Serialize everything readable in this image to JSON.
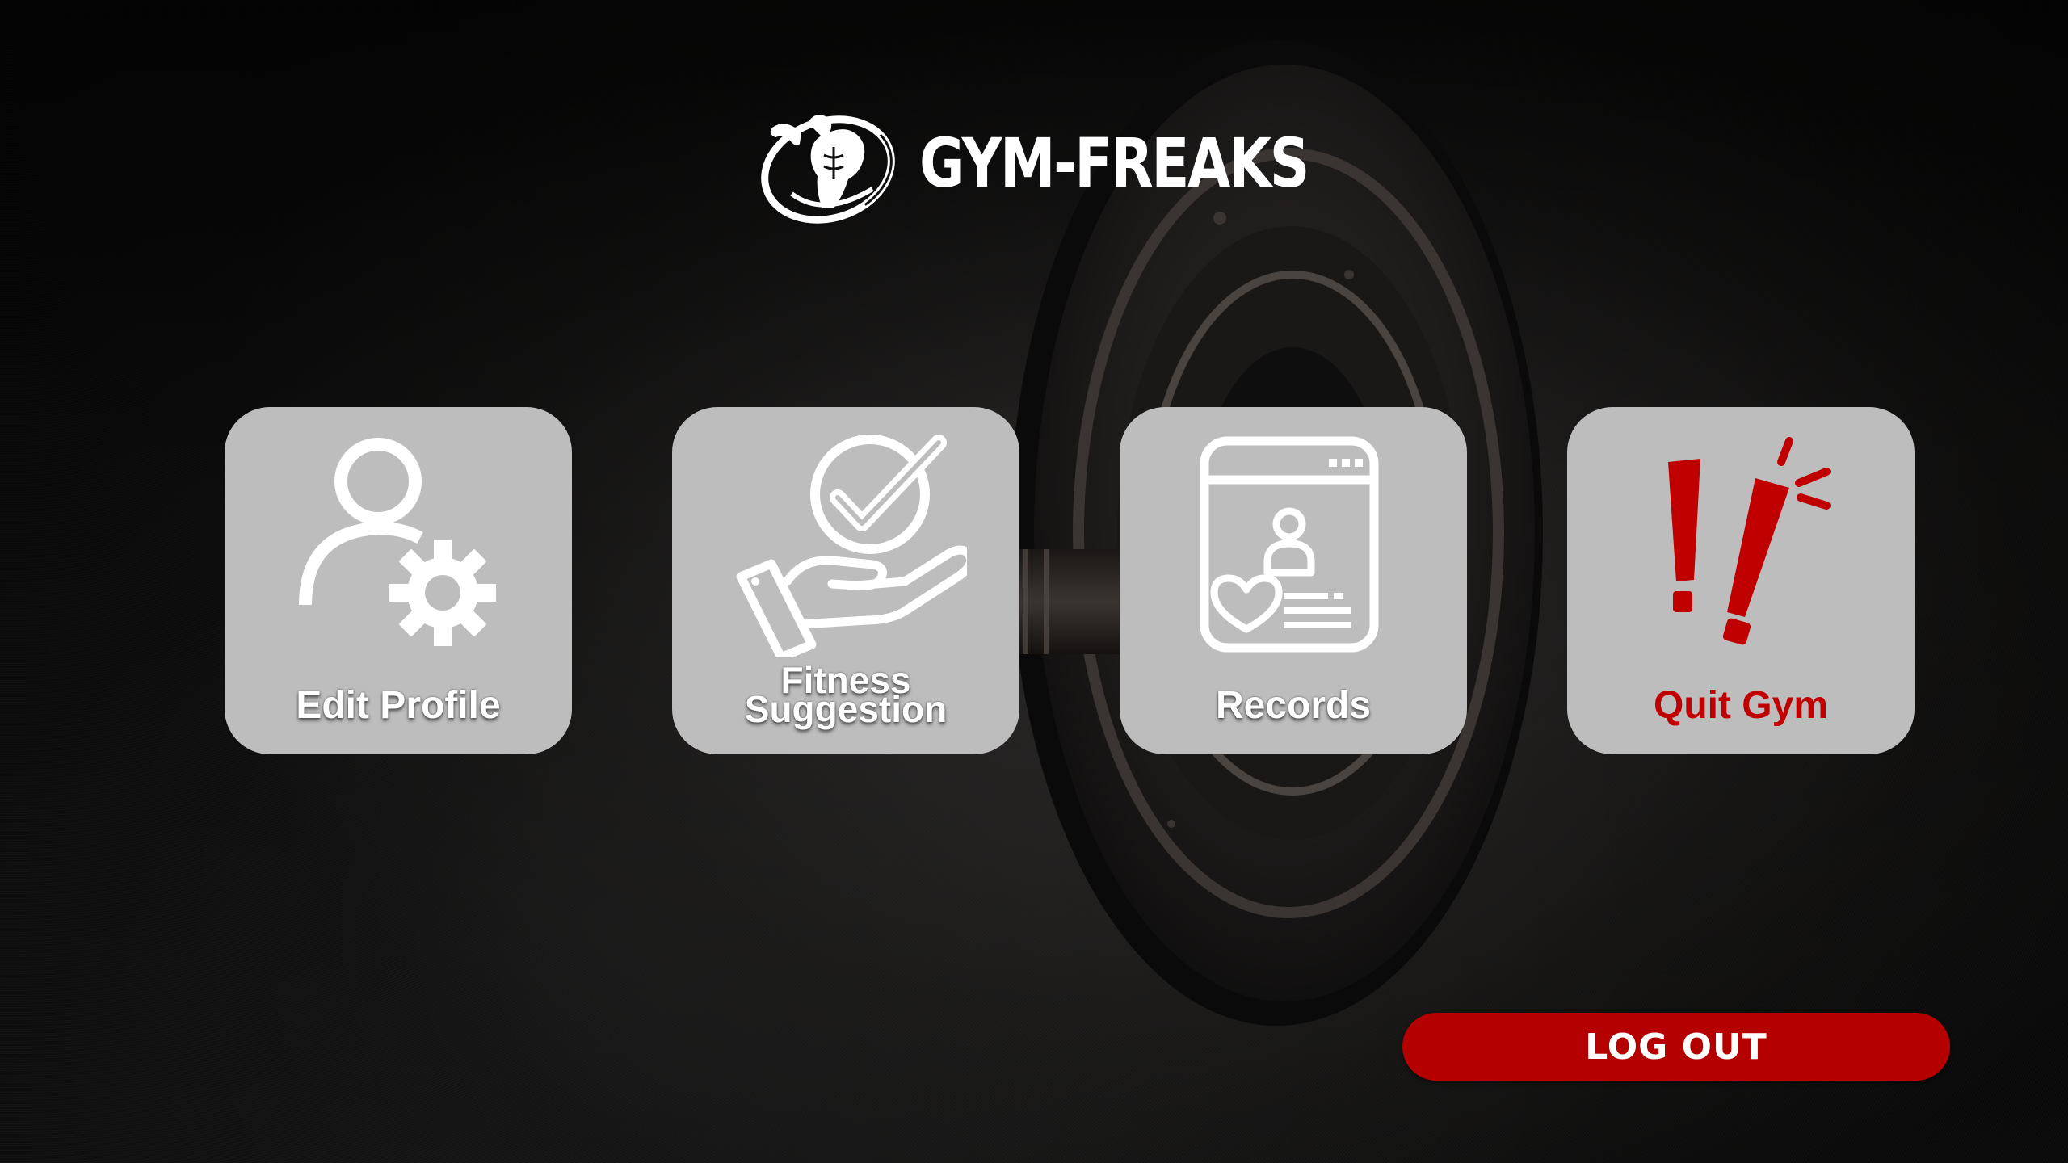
{
  "brand": {
    "name": "GYM-FREAKS",
    "logo_icon": "bodybuilder-logo-icon"
  },
  "tiles": [
    {
      "label": "Edit Profile",
      "icon": "user-gear-icon"
    },
    {
      "label_line1": "Fitness",
      "label_line2": "Suggestion",
      "icon": "hand-checkmark-icon"
    },
    {
      "label": "Records",
      "icon": "profile-card-icon"
    },
    {
      "label": "Quit Gym",
      "icon": "exclamation-icon"
    }
  ],
  "logout": {
    "label": "LOG OUT"
  },
  "colors": {
    "tile_bg": "#bdbdbd",
    "accent_red": "#b50000",
    "quit_text": "#c00000",
    "icon_white": "#ffffff"
  }
}
